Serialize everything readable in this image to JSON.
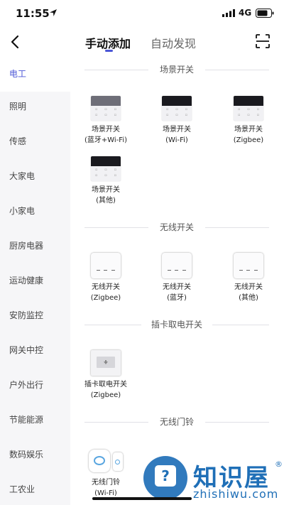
{
  "status_bar": {
    "time": "11:55",
    "network": "4G"
  },
  "nav": {
    "tabs": [
      {
        "label": "手动添加",
        "active": true
      },
      {
        "label": "自动发现",
        "active": false
      }
    ],
    "accent_color": "#4b56d6"
  },
  "sidebar": {
    "items": [
      {
        "label": "电工",
        "active": true
      },
      {
        "label": "照明"
      },
      {
        "label": "传感"
      },
      {
        "label": "大家电"
      },
      {
        "label": "小家电"
      },
      {
        "label": "厨房电器"
      },
      {
        "label": "运动健康"
      },
      {
        "label": "安防监控"
      },
      {
        "label": "网关中控"
      },
      {
        "label": "户外出行"
      },
      {
        "label": "节能能源"
      },
      {
        "label": "数码娱乐"
      },
      {
        "label": "工农业"
      }
    ]
  },
  "sections": [
    {
      "title": "场景开关",
      "devices": [
        {
          "name": "场景开关",
          "sub": "(蓝牙+Wi-Fi)",
          "icon": "scene-switch-icon"
        },
        {
          "name": "场景开关",
          "sub": "(Wi-Fi)",
          "icon": "scene-switch-icon"
        },
        {
          "name": "场景开关",
          "sub": "(Zigbee)",
          "icon": "scene-switch-icon"
        },
        {
          "name": "场景开关",
          "sub": "(其他)",
          "icon": "scene-switch-icon"
        }
      ]
    },
    {
      "title": "无线开关",
      "devices": [
        {
          "name": "无线开关",
          "sub": "(Zigbee)",
          "icon": "wireless-switch-icon"
        },
        {
          "name": "无线开关",
          "sub": "(蓝牙)",
          "icon": "wireless-switch-icon"
        },
        {
          "name": "无线开关",
          "sub": "(其他)",
          "icon": "wireless-switch-icon"
        }
      ]
    },
    {
      "title": "插卡取电开关",
      "devices": [
        {
          "name": "插卡取电开关",
          "sub": "(Zigbee)",
          "icon": "card-switch-icon"
        }
      ]
    },
    {
      "title": "无线门铃",
      "devices": [
        {
          "name": "无线门铃",
          "sub": "(Wi-Fi)",
          "icon": "doorbell-icon"
        }
      ]
    }
  ],
  "watermark": {
    "text": "知识屋",
    "sub": "zhishiwu.com",
    "mark": "®",
    "glyph": "?"
  }
}
